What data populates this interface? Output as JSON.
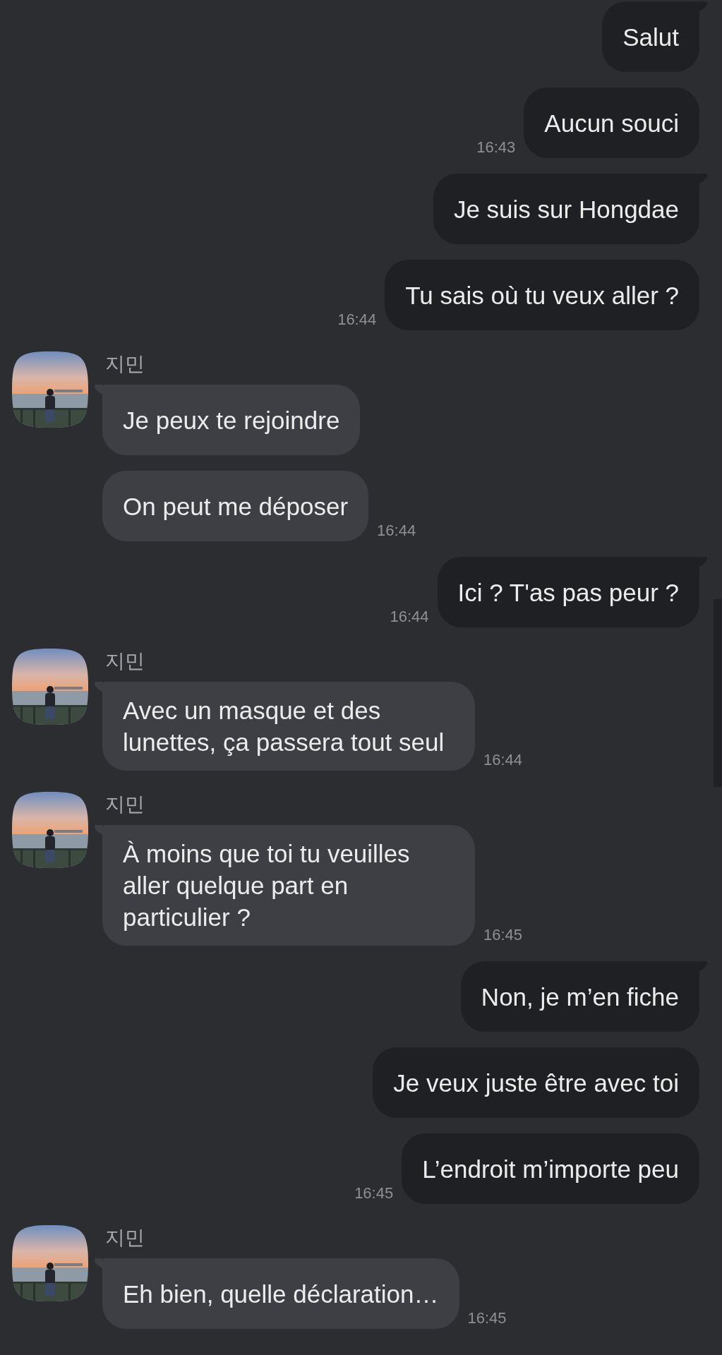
{
  "messages": [
    {
      "kind": "sent",
      "text": "Salut",
      "tail": true
    },
    {
      "kind": "sent",
      "text": "Aucun souci",
      "tail": false,
      "time": "16:43"
    },
    {
      "kind": "sent",
      "text": "Je suis sur Hongdae",
      "tail": true
    },
    {
      "kind": "sent",
      "text": "Tu sais où tu veux aller ?",
      "tail": false,
      "time": "16:44"
    },
    {
      "kind": "received",
      "sender": "지민",
      "text": "Je peux te rejoindre",
      "tail": true
    },
    {
      "kind": "received",
      "text": "On peut me déposer",
      "tail": false,
      "time": "16:44"
    },
    {
      "kind": "sent",
      "text": "Ici ? T'as pas peur ?",
      "tail": true,
      "time": "16:44"
    },
    {
      "kind": "received",
      "sender": "지민",
      "text": "Avec un masque et des lunettes, ça passera tout seul",
      "tail": true,
      "time": "16:44"
    },
    {
      "kind": "received",
      "sender": "지민",
      "text": "À moins que toi tu veuilles aller quelque part en particulier ?",
      "tail": true,
      "time": "16:45"
    },
    {
      "kind": "sent",
      "text": "Non, je m’en fiche",
      "tail": true
    },
    {
      "kind": "sent",
      "text": "Je veux juste être avec toi",
      "tail": false
    },
    {
      "kind": "sent",
      "text": "L’endroit m’importe peu",
      "tail": false,
      "time": "16:45"
    },
    {
      "kind": "received",
      "sender": "지민",
      "text": "Eh bien, quelle déclaration…",
      "tail": true,
      "time": "16:45"
    }
  ]
}
